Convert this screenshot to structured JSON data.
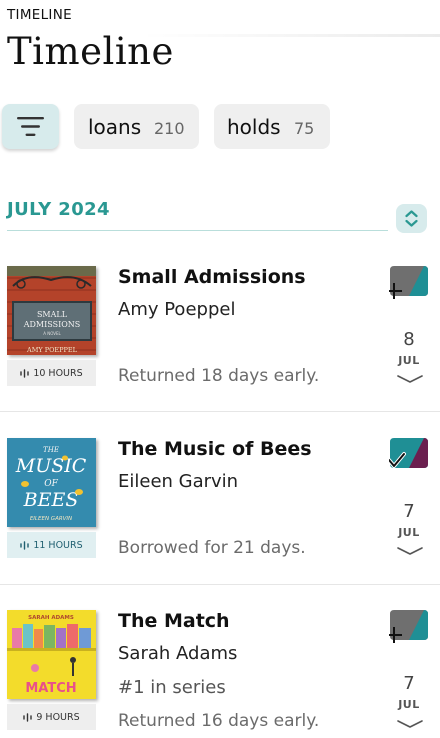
{
  "header": {
    "small_title": "TIMELINE",
    "large_title": "Timeline"
  },
  "filters": {
    "loans": {
      "label": "loans",
      "count": "210"
    },
    "holds": {
      "label": "holds",
      "count": "75"
    }
  },
  "section": {
    "month": "JULY 2024"
  },
  "items": [
    {
      "title": "Small Admissions",
      "author": "Amy Poeppel",
      "duration": "10 HOURS",
      "status": "Returned 18 days early.",
      "day": "8",
      "month": "JUL",
      "cover_text_1": "SMALL",
      "cover_text_2": "ADMISSIONS",
      "cover_text_3": "A NOVEL",
      "cover_text_4": "AMY POEPPEL",
      "action": "add"
    },
    {
      "title": "The Music of Bees",
      "author": "Eileen Garvin",
      "duration": "11 HOURS",
      "status": "Borrowed for 21 days.",
      "day": "7",
      "month": "JUL",
      "cover_text_1": "THE",
      "cover_text_2": "MUSIC",
      "cover_text_3": "OF",
      "cover_text_4": "BEES",
      "cover_text_5": "EILEEN GARVIN",
      "action": "check"
    },
    {
      "title": "The Match",
      "author": "Sarah Adams",
      "series": "#1 in series",
      "duration": "9 HOURS",
      "status": "Returned 16 days early.",
      "day": "7",
      "month": "JUL",
      "cover_text_1": "SARAH ADAMS",
      "cover_text_2": "MATCH",
      "action": "add"
    }
  ],
  "colors": {
    "accent": "#2a9892",
    "chip_active": "#d7ebec",
    "teal": "#1f8f95",
    "purple": "#6b1f4f",
    "gray_tag": "#6f6f6f"
  }
}
